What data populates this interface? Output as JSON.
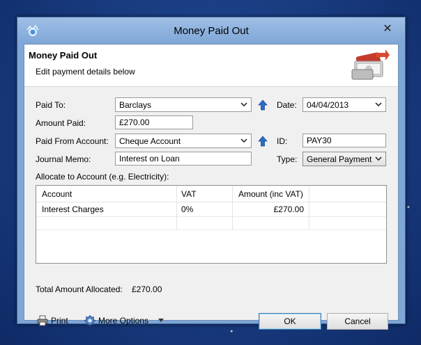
{
  "window": {
    "title": "Money Paid Out",
    "close_label": "✕"
  },
  "header": {
    "title": "Money Paid Out",
    "subtitle": "Edit payment details below"
  },
  "form": {
    "paid_to": {
      "label": "Paid To:",
      "value": "Barclays"
    },
    "amount_paid": {
      "label": "Amount Paid:",
      "value": "£270.00"
    },
    "paid_from_account": {
      "label": "Paid From Account:",
      "value": "Cheque Account"
    },
    "journal_memo": {
      "label": "Journal Memo:",
      "value": "Interest on Loan"
    },
    "date": {
      "label": "Date:",
      "value": "04/04/2013"
    },
    "id": {
      "label": "ID:",
      "value": "PAY30"
    },
    "type": {
      "label": "Type:",
      "value": "General Payment"
    }
  },
  "allocate": {
    "label": "Allocate to Account (e.g. Electricity):",
    "columns": [
      "Account",
      "VAT",
      "Amount (inc VAT)"
    ],
    "rows": [
      {
        "account": "Interest Charges",
        "vat": "0%",
        "amount": "£270.00"
      }
    ]
  },
  "total": {
    "label": "Total Amount Allocated:",
    "value": "£270.00"
  },
  "footer": {
    "print_label": "Print",
    "more_options_label": "More Options",
    "ok_label": "OK",
    "cancel_label": "Cancel"
  },
  "icons": {
    "app": "app-logo-icon",
    "up": "up-arrow-icon",
    "print": "printer-icon",
    "options": "gear-icon",
    "dropdown": "chevron-down-icon"
  },
  "colors": {
    "titlebar": "#7ea6d6",
    "up_arrow": "#2b6cc4",
    "default_button_border": "#3c7fb1"
  }
}
